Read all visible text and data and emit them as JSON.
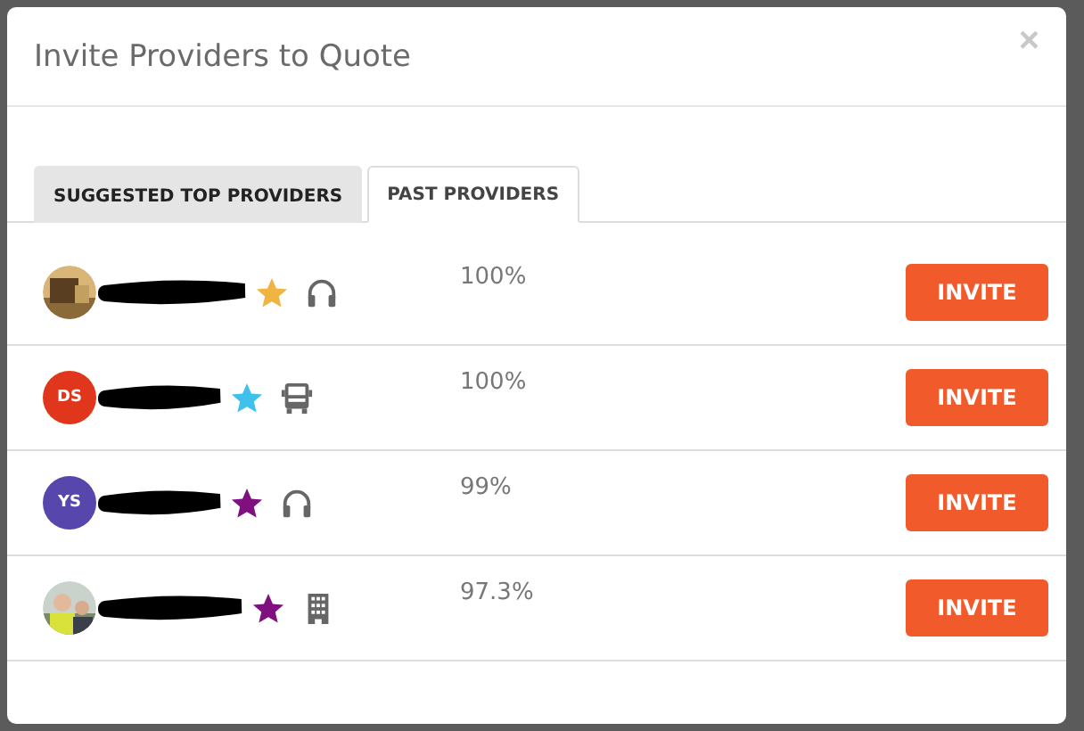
{
  "dialog": {
    "title": "Invite Providers to Quote",
    "close": "×"
  },
  "tabs": [
    {
      "label": "SUGGESTED TOP PROVIDERS",
      "selected": false
    },
    {
      "label": "PAST PROVIDERS",
      "selected": true
    }
  ],
  "providers": [
    {
      "star": {
        "color": "#f0b443"
      },
      "icon": {
        "kind": "headset"
      },
      "rating": "100%",
      "action": "INVITE"
    },
    {
      "avatar": {
        "kind": "initials",
        "text": "DS",
        "color": "#e0361b"
      },
      "star": {
        "color": "#3ec1ea"
      },
      "icon": {
        "kind": "truck"
      },
      "rating": "100%",
      "action": "INVITE"
    },
    {
      "avatar": {
        "kind": "initials",
        "text": "YS",
        "color": "#5747ad"
      },
      "star": {
        "color": "#800f80"
      },
      "icon": {
        "kind": "headset"
      },
      "rating": "99%",
      "action": "INVITE"
    },
    {
      "star": {
        "color": "#800f80"
      },
      "icon": {
        "kind": "building"
      },
      "rating": "97.3%",
      "action": "INVITE"
    }
  ]
}
